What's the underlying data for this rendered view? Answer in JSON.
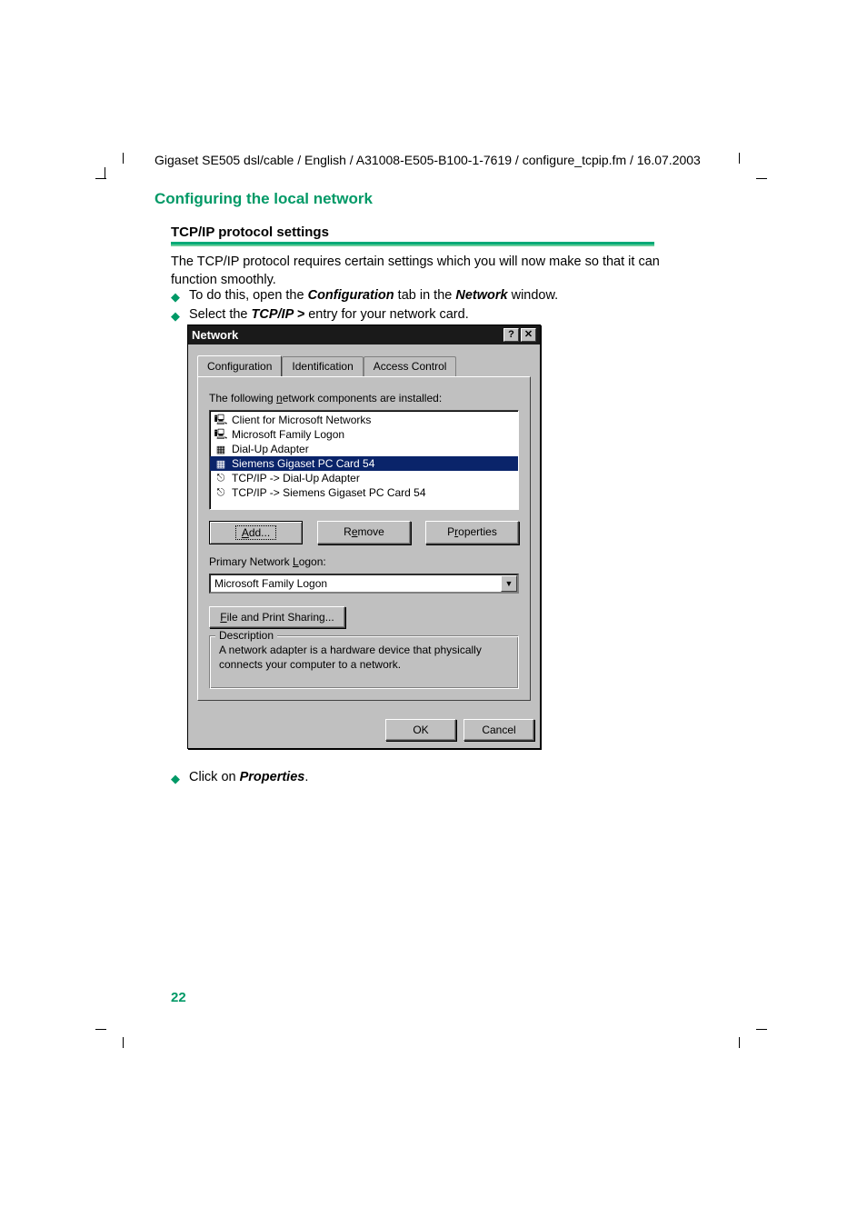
{
  "header": {
    "path": "Gigaset SE505 dsl/cable / English / A31008-E505-B100-1-7619 / configure_tcpip.fm / 16.07.2003"
  },
  "section": {
    "title": "Configuring the local network",
    "subtitle": "TCP/IP protocol settings",
    "intro": "The TCP/IP protocol requires certain settings which you will now make so that it can function smoothly.",
    "bullet1_pre": "To do this, open the ",
    "bullet1_b1": "Configuration",
    "bullet1_mid": " tab in the ",
    "bullet1_b2": "Network",
    "bullet1_suf": " window.",
    "bullet2_pre": "Select the ",
    "bullet2_b1": "TCP/IP >",
    "bullet2_suf": " entry for your network card.",
    "bullet3_pre": "Click on ",
    "bullet3_b1": "Properties",
    "bullet3_suf": "."
  },
  "dialog": {
    "title": "Network",
    "tabs": {
      "t1": "Configuration",
      "t2": "Identification",
      "t3": "Access Control"
    },
    "components_label_pre": "The following ",
    "components_label_u": "n",
    "components_label_post": "etwork components are installed:",
    "items": {
      "i0": "Client for Microsoft Networks",
      "i1": "Microsoft Family Logon",
      "i2": "Dial-Up Adapter",
      "i3": "Siemens Gigaset PC Card 54",
      "i4": "TCP/IP -> Dial-Up Adapter",
      "i5": "TCP/IP -> Siemens Gigaset PC Card 54"
    },
    "buttons": {
      "add_u": "A",
      "add_rest": "dd...",
      "remove_pre": "R",
      "remove_u": "e",
      "remove_post": "move",
      "props_pre": "P",
      "props_u": "r",
      "props_post": "operties"
    },
    "primary_label_pre": "Primary Network ",
    "primary_label_u": "L",
    "primary_label_post": "ogon:",
    "primary_value": "Microsoft Family Logon",
    "fps_u": "F",
    "fps_rest": "ile and Print Sharing...",
    "desc_label": "Description",
    "desc_text": "A network adapter is a hardware device that physically connects your computer to a network.",
    "ok": "OK",
    "cancel": "Cancel"
  },
  "page_number": "22"
}
